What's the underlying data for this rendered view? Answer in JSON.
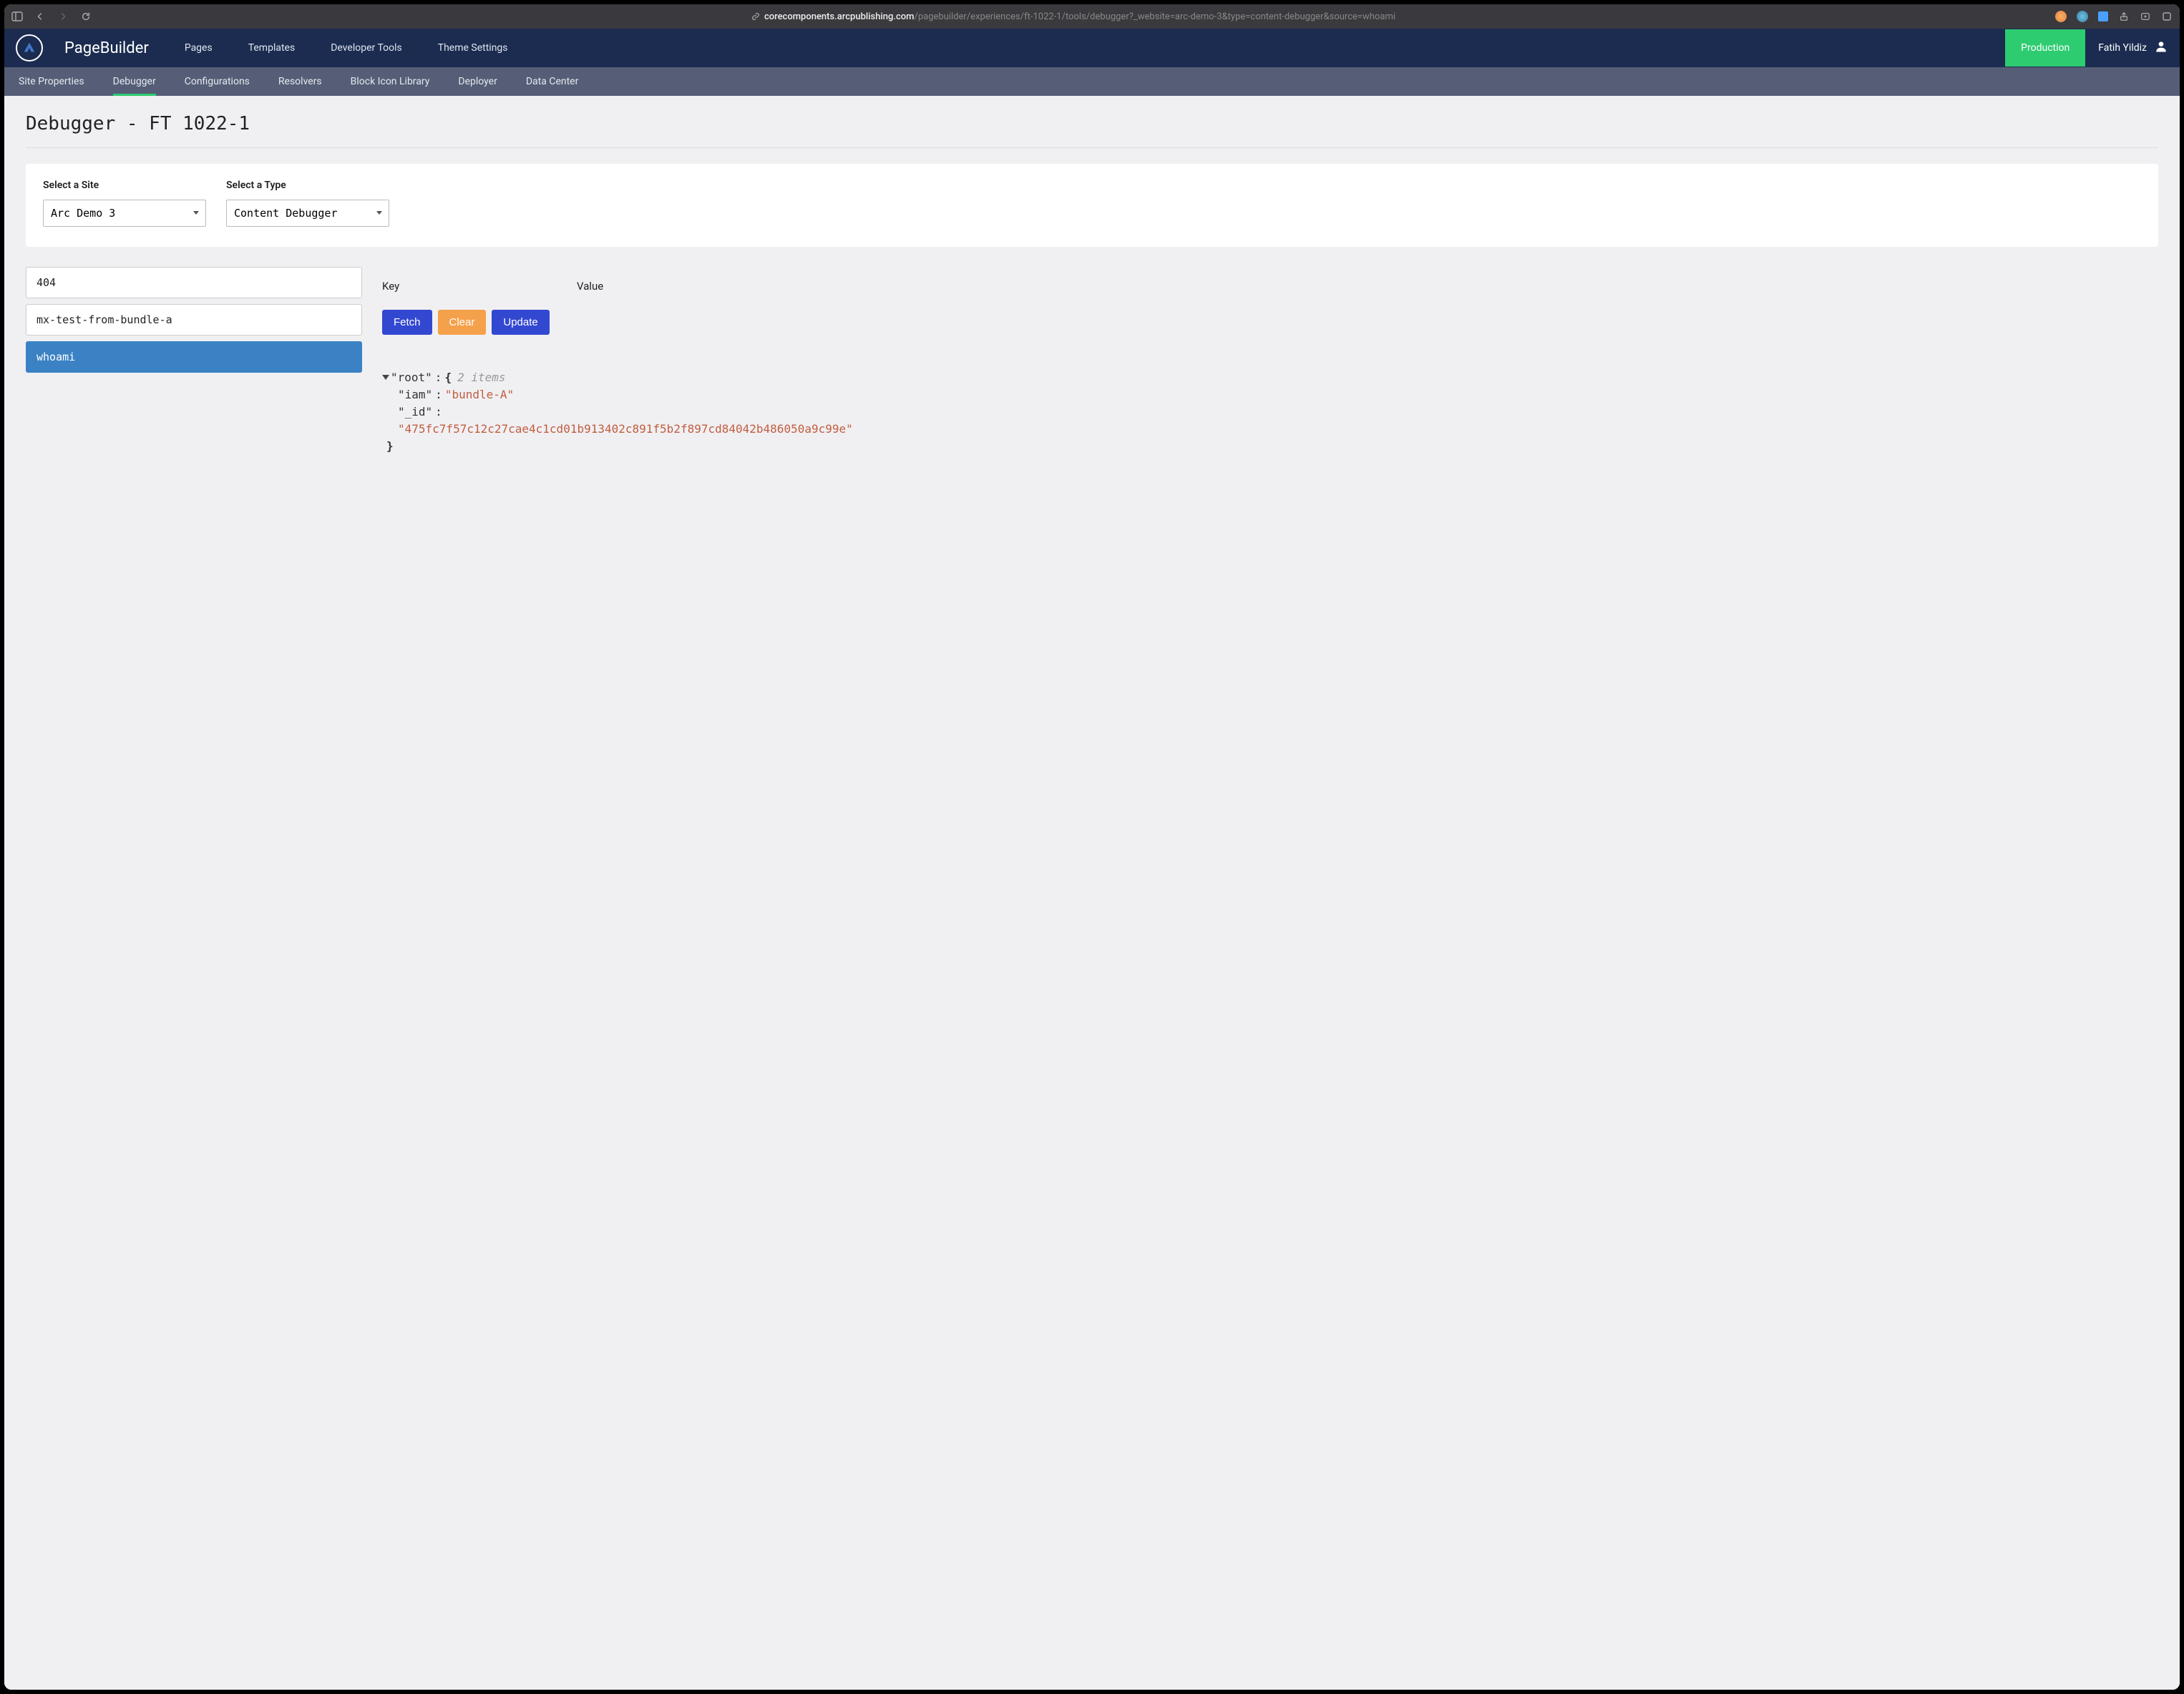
{
  "browser": {
    "url_domain": "corecomponents.arcpublishing.com",
    "url_path": "/pagebuilder/experiences/ft-1022-1/tools/debugger?_website=arc-demo-3&type=content-debugger&source=whoami"
  },
  "brand": "PageBuilder",
  "top_nav": {
    "items": [
      "Pages",
      "Templates",
      "Developer Tools",
      "Theme Settings"
    ]
  },
  "env_badge": "Production",
  "user": "Fatih Yildiz",
  "sub_nav": {
    "items": [
      "Site Properties",
      "Debugger",
      "Configurations",
      "Resolvers",
      "Block Icon Library",
      "Deployer",
      "Data Center"
    ],
    "active_index": 1
  },
  "page_title": "Debugger - FT 1022-1",
  "selectors": {
    "site": {
      "label": "Select a Site",
      "value": "Arc Demo 3"
    },
    "type": {
      "label": "Select a Type",
      "value": "Content Debugger"
    }
  },
  "sources": {
    "items": [
      "404",
      "mx-test-from-bundle-a",
      "whoami"
    ],
    "selected_index": 2
  },
  "kv": {
    "key_label": "Key",
    "value_label": "Value"
  },
  "buttons": {
    "fetch": "Fetch",
    "clear": "Clear",
    "update": "Update"
  },
  "json": {
    "root_label": "\"root\"",
    "brace_open": "{",
    "brace_close": "}",
    "colon": ":",
    "items_meta": "2 items",
    "iam_key": "\"iam\"",
    "iam_val": "\"bundle-A\"",
    "id_key": "\"_id\"",
    "id_val": "\"475fc7f57c12c27cae4c1cd01b913402c891f5b2f897cd84042b486050a9c99e\""
  }
}
